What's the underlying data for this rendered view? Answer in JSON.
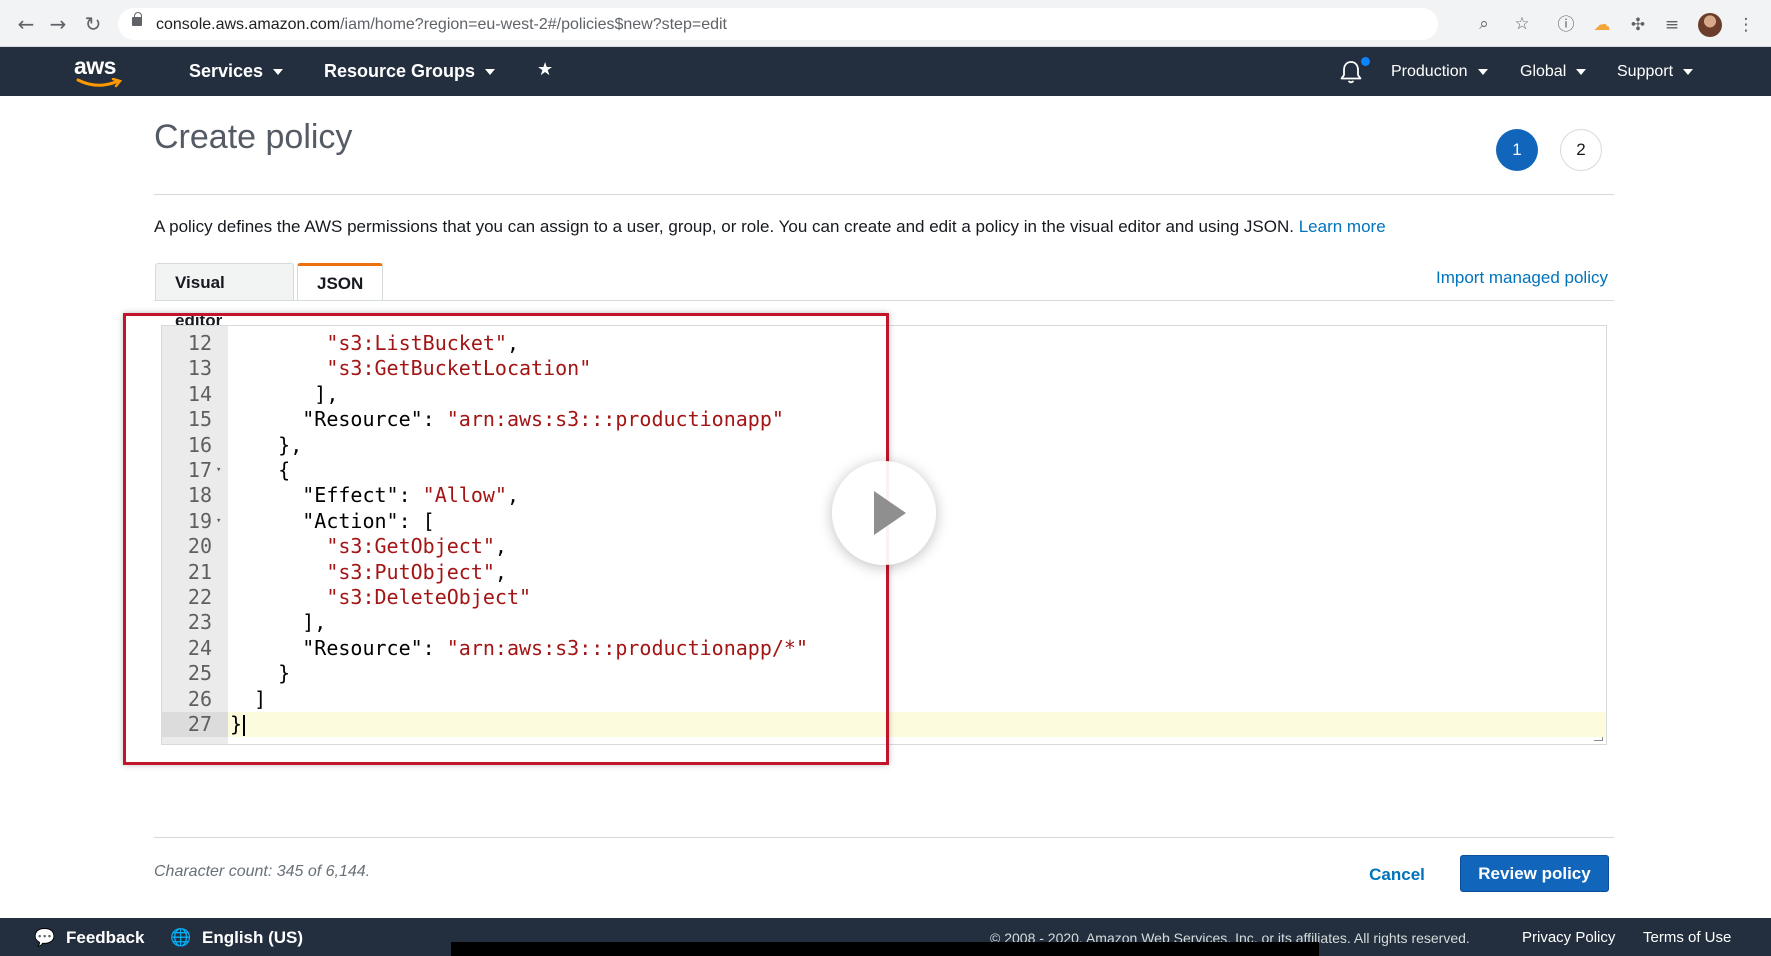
{
  "browser": {
    "url_host": "console.aws.amazon.com",
    "url_path": "/iam/home?region=eu-west-2#/policies$new?step=edit"
  },
  "aws_nav": {
    "logo": "aws",
    "services": "Services",
    "resource_groups": "Resource Groups",
    "account": "Production",
    "region": "Global",
    "support": "Support"
  },
  "page": {
    "title": "Create policy",
    "steps": [
      "1",
      "2"
    ],
    "description": "A policy defines the AWS permissions that you can assign to a user, group, or role. You can create and edit a policy in the visual editor and using JSON.",
    "learn_more": "Learn more",
    "tabs": [
      "Visual editor",
      "JSON"
    ],
    "active_tab": "JSON",
    "import_managed_policy": "Import managed policy"
  },
  "editor": {
    "lines": [
      {
        "num": "12",
        "text": "        \"s3:ListBucket\","
      },
      {
        "num": "13",
        "text": "        \"s3:GetBucketLocation\""
      },
      {
        "num": "14",
        "text": "       ],"
      },
      {
        "num": "15",
        "text": "      \"Resource\": \"arn:aws:s3:::productionapp\""
      },
      {
        "num": "16",
        "text": "    },"
      },
      {
        "num": "17",
        "text": "    {"
      },
      {
        "num": "18",
        "text": "      \"Effect\": \"Allow\","
      },
      {
        "num": "19",
        "text": "      \"Action\": ["
      },
      {
        "num": "20",
        "text": "        \"s3:GetObject\","
      },
      {
        "num": "21",
        "text": "        \"s3:PutObject\","
      },
      {
        "num": "22",
        "text": "        \"s3:DeleteObject\""
      },
      {
        "num": "23",
        "text": "      ],"
      },
      {
        "num": "24",
        "text": "      \"Resource\": \"arn:aws:s3:::productionapp/*\""
      },
      {
        "num": "25",
        "text": "    }"
      },
      {
        "num": "26",
        "text": "  ]"
      },
      {
        "num": "27",
        "text": "}"
      }
    ],
    "fold_lines": [
      "17",
      "19"
    ],
    "active_line": "27"
  },
  "footer_bar": {
    "character_count": "Character count: 345 of 6,144.",
    "cancel": "Cancel",
    "review_policy": "Review policy"
  },
  "aws_footer": {
    "feedback": "Feedback",
    "language": "English (US)",
    "copyright": "© 2008 - 2020, Amazon Web Services, Inc. or its affiliates. All rights reserved.",
    "privacy_policy": "Privacy Policy",
    "terms_of_use": "Terms of Use"
  },
  "icons": {
    "back": "arrow-left-icon",
    "forward": "arrow-right-icon",
    "reload": "reload-icon",
    "lock": "lock-icon",
    "zoom": "zoom-icon",
    "bookmark": "star-icon",
    "bell": "bell-icon",
    "pin": "pin-icon",
    "play": "play-icon"
  },
  "colors": {
    "aws_nav": "#232f3e",
    "primary_button": "#1166bb",
    "link": "#0073bb",
    "tab_accent": "#ec7211",
    "highlight_box": "#c0152a",
    "json_string": "#a31515"
  }
}
